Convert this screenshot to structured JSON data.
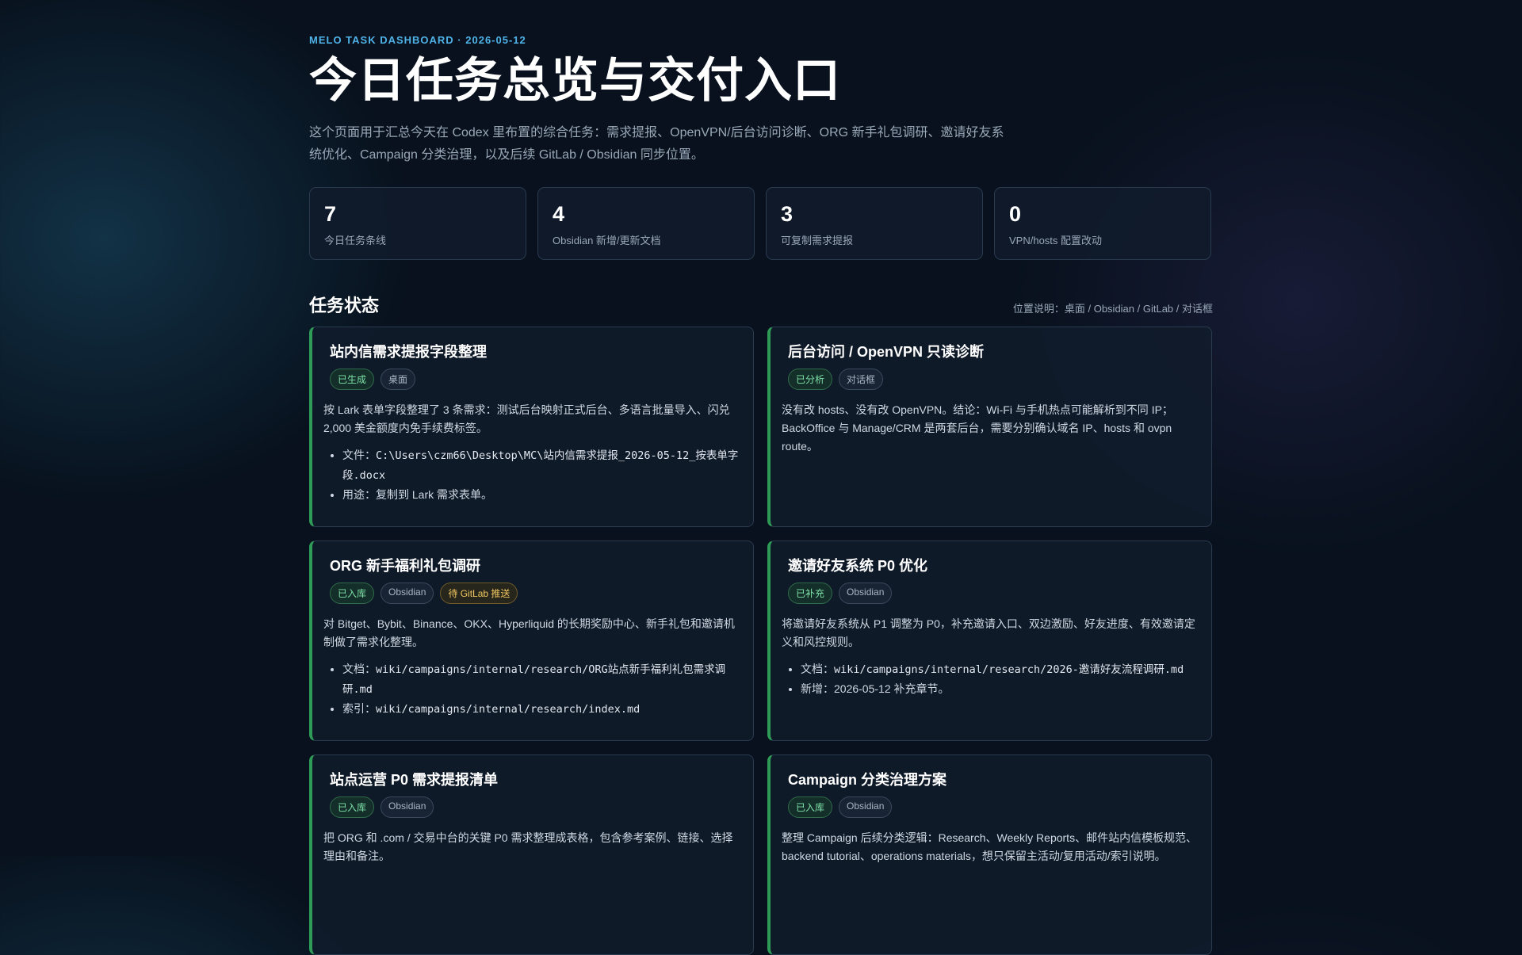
{
  "header": {
    "eyebrow": "MELO TASK DASHBOARD · 2026-05-12",
    "title": "今日任务总览与交付入口",
    "intro": "这个页面用于汇总今天在 Codex 里布置的综合任务：需求提报、OpenVPN/后台访问诊断、ORG 新手礼包调研、邀请好友系统优化、Campaign 分类治理，以及后续 GitLab / Obsidian 同步位置。"
  },
  "stats": [
    {
      "value": "7",
      "label": "今日任务条线"
    },
    {
      "value": "4",
      "label": "Obsidian 新增/更新文档"
    },
    {
      "value": "3",
      "label": "可复制需求提报"
    },
    {
      "value": "0",
      "label": "VPN/hosts 配置改动"
    }
  ],
  "section": {
    "title": "任务状态",
    "note": "位置说明：桌面 / Obsidian / GitLab / 对话框"
  },
  "cards": [
    {
      "title": "站内信需求提报字段整理",
      "tags": [
        {
          "text": "已生成",
          "style": "green"
        },
        {
          "text": "桌面",
          "style": "gray"
        }
      ],
      "desc": "按 Lark 表单字段整理了 3 条需求：测试后台映射正式后台、多语言批量导入、闪兑 2,000 美金额度内免手续费标签。",
      "items": [
        {
          "prefix": "文件：",
          "code": "C:\\Users\\czm66\\Desktop\\MC\\站内信需求提报_2026-05-12_按表单字段.docx",
          "text": ""
        },
        {
          "prefix": "用途：",
          "code": "",
          "text": "复制到 Lark 需求表单。"
        }
      ]
    },
    {
      "title": "后台访问 / OpenVPN 只读诊断",
      "tags": [
        {
          "text": "已分析",
          "style": "green"
        },
        {
          "text": "对话框",
          "style": "gray"
        }
      ],
      "desc": "没有改 hosts、没有改 OpenVPN。结论：Wi-Fi 与手机热点可能解析到不同 IP；BackOffice 与 Manage/CRM 是两套后台，需要分别确认域名 IP、hosts 和 ovpn route。",
      "items": []
    },
    {
      "title": "ORG 新手福利礼包调研",
      "tags": [
        {
          "text": "已入库",
          "style": "green"
        },
        {
          "text": "Obsidian",
          "style": "gray"
        },
        {
          "text": "待 GitLab 推送",
          "style": "yellow"
        }
      ],
      "desc": "对 Bitget、Bybit、Binance、OKX、Hyperliquid 的长期奖励中心、新手礼包和邀请机制做了需求化整理。",
      "items": [
        {
          "prefix": "文档：",
          "code": "wiki/campaigns/internal/research/ORG站点新手福利礼包需求调研.md",
          "text": ""
        },
        {
          "prefix": "索引：",
          "code": "wiki/campaigns/internal/research/index.md",
          "text": ""
        }
      ]
    },
    {
      "title": "邀请好友系统 P0 优化",
      "tags": [
        {
          "text": "已补充",
          "style": "green"
        },
        {
          "text": "Obsidian",
          "style": "gray"
        }
      ],
      "desc": "将邀请好友系统从 P1 调整为 P0，补充邀请入口、双边激励、好友进度、有效邀请定义和风控规则。",
      "items": [
        {
          "prefix": "文档：",
          "code": "wiki/campaigns/internal/research/2026-邀请好友流程调研.md",
          "text": ""
        },
        {
          "prefix": "新增：",
          "code": "",
          "text": "2026-05-12 补充章节。"
        }
      ]
    },
    {
      "title": "站点运营 P0 需求提报清单",
      "tags": [
        {
          "text": "已入库",
          "style": "green"
        },
        {
          "text": "Obsidian",
          "style": "gray"
        }
      ],
      "desc": "把 ORG 和 .com / 交易中台的关键 P0 需求整理成表格，包含参考案例、链接、选择理由和备注。",
      "items": []
    },
    {
      "title": "Campaign 分类治理方案",
      "tags": [
        {
          "text": "已入库",
          "style": "green"
        },
        {
          "text": "Obsidian",
          "style": "gray"
        }
      ],
      "desc": "整理 Campaign 后续分类逻辑：Research、Weekly Reports、邮件站内信模板规范、backend tutorial、operations materials，想只保留主活动/复用活动/索引说明。",
      "items": []
    }
  ]
}
